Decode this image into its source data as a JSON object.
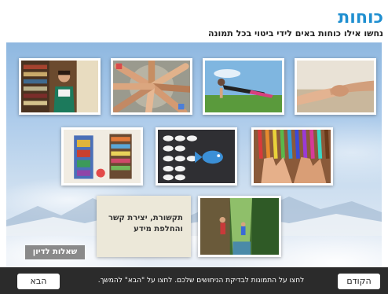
{
  "header": {
    "title": "כוחות",
    "subtitle": "נחשו אילו כוחות באים לידי ביטוי בכל תמונה"
  },
  "photos": [
    {
      "subject": "reading-in-library"
    },
    {
      "subject": "hands-joined-circle"
    },
    {
      "subject": "plank-exercise"
    },
    {
      "subject": "holding-hands"
    },
    {
      "subject": "creative-colorful-room"
    },
    {
      "subject": "fish-swimming-opposite"
    },
    {
      "subject": "hands-with-colored-pencils"
    },
    {
      "subject": "hikers-in-forest"
    }
  ],
  "card": {
    "line1": "תקשורת, יצירת קשר",
    "line2": "והחלפת מידע"
  },
  "questions_button": "שאלות לדיון",
  "footer": {
    "prev_label": "הקודם",
    "next_label": "הבא",
    "instruction": "לחצו על התמונות לבדיקת הניחושים שלכם. לחצו על \"הבא\" להמשך."
  }
}
